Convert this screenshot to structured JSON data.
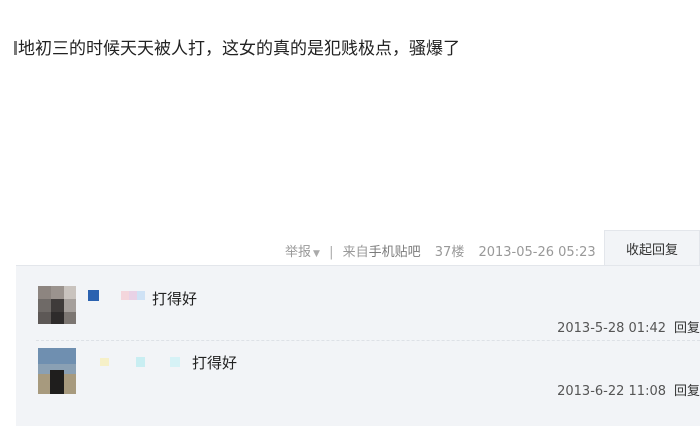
{
  "post": {
    "text": "地初三的时候天天被人打，这女的真的是犯贱极点，骚爆了",
    "report_label": "举报",
    "separator": "|",
    "source_prefix": "来自",
    "source_link": "手机贴吧",
    "floor": "37楼",
    "time": "2013-05-26 05:23",
    "collapse_label": "收起回复"
  },
  "replies": [
    {
      "text": "打得好",
      "time": "2013-5-28 01:42",
      "reply_label": "回复"
    },
    {
      "text": "打得好",
      "time": "2013-6-22 11:08",
      "reply_label": "回复"
    }
  ],
  "colors": {
    "accent_blue": "#2b62b0",
    "panel_bg": "#f2f4f7",
    "meta_gray": "#999999"
  }
}
